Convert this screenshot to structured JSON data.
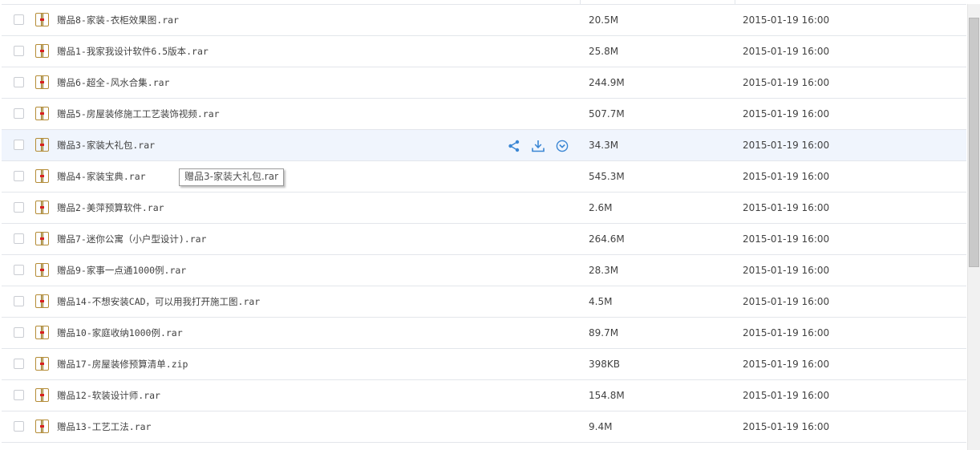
{
  "files": [
    {
      "name": "赠品8-家装-衣柜效果图.rar",
      "size": "20.5M",
      "date": "2015-01-19 16:00"
    },
    {
      "name": "赠品1-我家我设计软件6.5版本.rar",
      "size": "25.8M",
      "date": "2015-01-19 16:00"
    },
    {
      "name": "赠品6-超全-风水合集.rar",
      "size": "244.9M",
      "date": "2015-01-19 16:00"
    },
    {
      "name": "赠品5-房屋装修施工工艺装饰视频.rar",
      "size": "507.7M",
      "date": "2015-01-19 16:00"
    },
    {
      "name": "赠品3-家装大礼包.rar",
      "size": "34.3M",
      "date": "2015-01-19 16:00"
    },
    {
      "name": "赠品4-家装宝典.rar",
      "size": "545.3M",
      "date": "2015-01-19 16:00"
    },
    {
      "name": "赠品2-美萍预算软件.rar",
      "size": "2.6M",
      "date": "2015-01-19 16:00"
    },
    {
      "name": "赠品7-迷你公寓（小户型设计).rar",
      "size": "264.6M",
      "date": "2015-01-19 16:00"
    },
    {
      "name": "赠品9-家事一点通1000例.rar",
      "size": "28.3M",
      "date": "2015-01-19 16:00"
    },
    {
      "name": "赠品14-不想安装CAD，可以用我打开施工图.rar",
      "size": "4.5M",
      "date": "2015-01-19 16:00"
    },
    {
      "name": "赠品10-家庭收纳1000例.rar",
      "size": "89.7M",
      "date": "2015-01-19 16:00"
    },
    {
      "name": "赠品17-房屋装修预算清单.zip",
      "size": "398KB",
      "date": "2015-01-19 16:00"
    },
    {
      "name": "赠品12-软装设计师.rar",
      "size": "154.8M",
      "date": "2015-01-19 16:00"
    },
    {
      "name": "赠品13-工艺工法.rar",
      "size": "9.4M",
      "date": "2015-01-19 16:00"
    }
  ],
  "hovered_row": 4,
  "row_actions": [
    "share-icon",
    "download-icon",
    "more-icon"
  ],
  "tooltip": {
    "text": "赠品3-家装大礼包.rar"
  },
  "colors": {
    "accent": "#3a86d4",
    "hover_row": "#f0f5fd",
    "row_border": "#e3e6eb"
  }
}
